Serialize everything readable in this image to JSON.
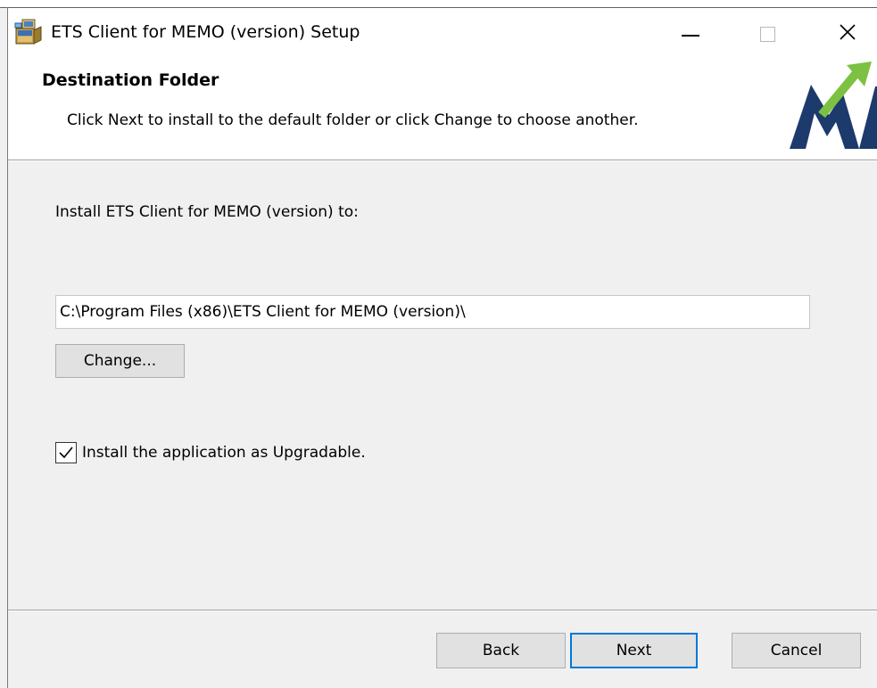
{
  "window": {
    "title": "ETS Client for MEMO (version) Setup"
  },
  "header": {
    "title": "Destination Folder",
    "subtitle": "Click Next to install to the default folder or click Change to choose another."
  },
  "main": {
    "install_label": "Install ETS Client for MEMO (version) to:",
    "path_value": "C:\\Program Files (x86)\\ETS Client for MEMO (version)\\",
    "change_label": "Change...",
    "upgradable_label": "Install the application as Upgradable.",
    "upgradable_checked": true
  },
  "footer": {
    "back_label": "Back",
    "next_label": "Next",
    "cancel_label": "Cancel"
  },
  "colors": {
    "logo_navy": "#1c3a6b",
    "logo_green": "#7dc142",
    "focus_blue": "#0078d7"
  },
  "icons": {
    "app": "installer-package-icon",
    "minimize": "minimize-icon",
    "maximize": "maximize-icon",
    "close": "close-icon",
    "check": "checkmark-icon"
  }
}
